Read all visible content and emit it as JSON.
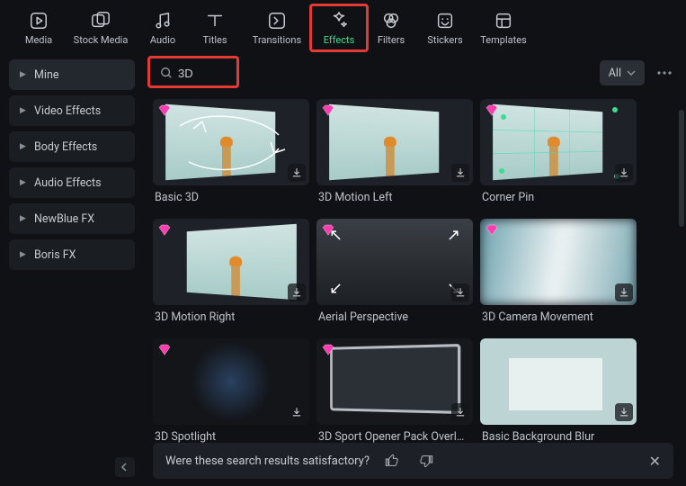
{
  "nav": {
    "items": [
      {
        "label": "Media",
        "icon": "media"
      },
      {
        "label": "Stock Media",
        "icon": "stock"
      },
      {
        "label": "Audio",
        "icon": "audio"
      },
      {
        "label": "Titles",
        "icon": "titles"
      },
      {
        "label": "Transitions",
        "icon": "transitions"
      },
      {
        "label": "Effects",
        "icon": "effects"
      },
      {
        "label": "Filters",
        "icon": "filters"
      },
      {
        "label": "Stickers",
        "icon": "stickers"
      },
      {
        "label": "Templates",
        "icon": "templates"
      }
    ],
    "active_index": 5,
    "highlight_nav": true
  },
  "sidebar": {
    "items": [
      "Mine",
      "Video Effects",
      "Body Effects",
      "Audio Effects",
      "NewBlue FX",
      "Boris FX"
    ],
    "selected_index": 0
  },
  "search": {
    "value": "3D",
    "highlight": true
  },
  "filter_dropdown": {
    "label": "All"
  },
  "effects": [
    {
      "title": "Basic 3D",
      "thumb": "basic3d",
      "premium": true
    },
    {
      "title": "3D Motion Left",
      "thumb": "motionleft",
      "premium": true
    },
    {
      "title": "Corner Pin",
      "thumb": "cornerpin",
      "premium": true
    },
    {
      "title": "3D Motion Right",
      "thumb": "motionright",
      "premium": true
    },
    {
      "title": "Aerial Perspective",
      "thumb": "aerial",
      "premium": true
    },
    {
      "title": "3D Camera Movement",
      "thumb": "camera",
      "premium": true
    },
    {
      "title": "3D Spotlight",
      "thumb": "spotlight",
      "premium": true
    },
    {
      "title": "3D Sport Opener Pack Overl…",
      "thumb": "sport",
      "premium": true
    },
    {
      "title": "Basic Background Blur",
      "thumb": "bgblur",
      "premium": false
    }
  ],
  "feedback": {
    "prompt": "Were these search results satisfactory?"
  },
  "colors": {
    "accent": "#3ddc91",
    "highlight": "#e53935",
    "gem": "#ff3db0"
  }
}
